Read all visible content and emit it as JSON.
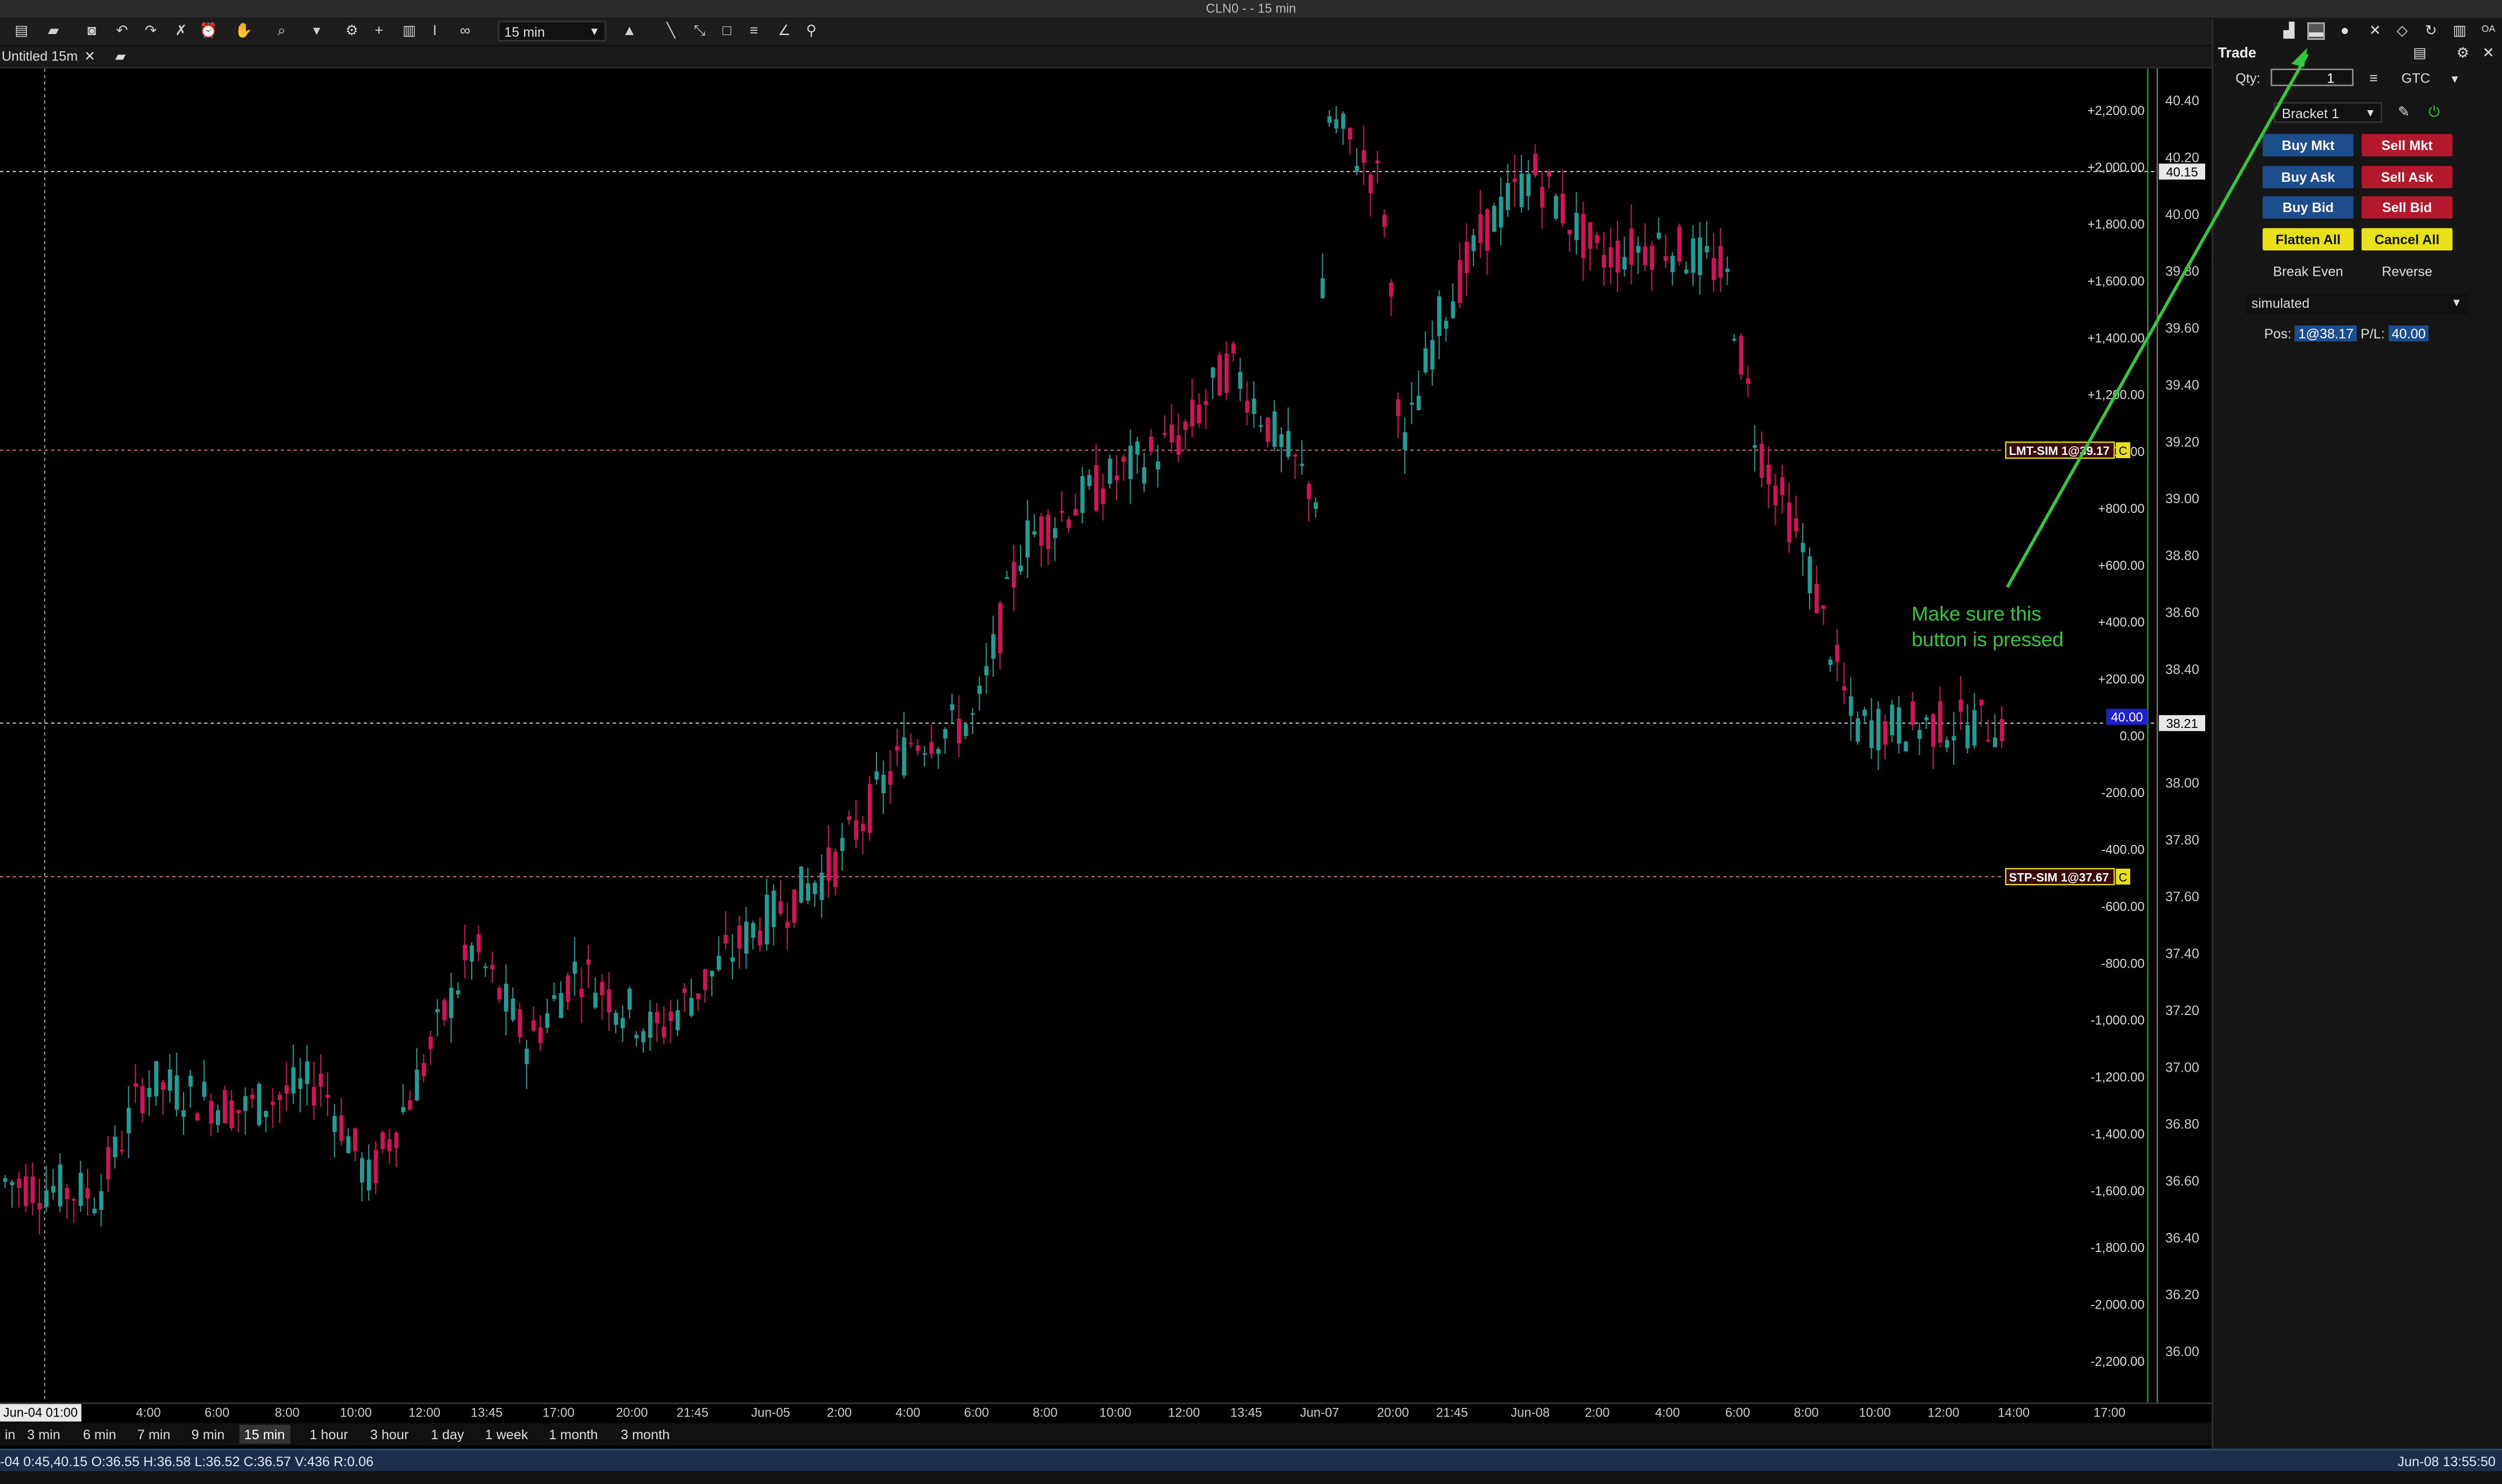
{
  "window": {
    "title": "CLN0 -  - 15 min"
  },
  "toolbar": {
    "timeframe": "15 min"
  },
  "tab": {
    "label": "Untitled 15m",
    "close": "✕"
  },
  "chart": {
    "colors": {
      "up": "#1f9e96",
      "down": "#d3125c",
      "grid_line": "#cfcfcf",
      "pnl_axis": "#2e9c3a"
    },
    "price_ticks": [
      "40.40",
      "40.20",
      "40.00",
      "39.80",
      "39.60",
      "39.40",
      "39.20",
      "39.00",
      "38.80",
      "38.60",
      "38.40",
      "38.20",
      "38.00",
      "37.80",
      "37.60",
      "37.40",
      "37.20",
      "37.00",
      "36.80",
      "36.60",
      "36.40",
      "36.20",
      "36.00"
    ],
    "pnl_ticks": [
      "+2,200.00",
      "+2,000.00",
      "+1,800.00",
      "+1,600.00",
      "+1,400.00",
      "+1,200.00",
      "+1,000.00",
      "+800.00",
      "+600.00",
      "+400.00",
      "+200.00",
      "0.00",
      "-200.00",
      "-400.00",
      "-600.00",
      "-800.00",
      "-1,000.00",
      "-1,200.00",
      "-1,400.00",
      "-1,600.00",
      "-1,800.00",
      "-2,000.00",
      "-2,200.00"
    ],
    "last_price_tag": "40.15",
    "current_price_tag": "38.21",
    "pnl_tag": "40.00",
    "orders": {
      "limit": {
        "label": "LMT-SIM 1@39.17",
        "price": 39.17,
        "cancel": "C"
      },
      "stop": {
        "label": "STP-SIM 1@37.67",
        "price": 37.67,
        "cancel": "C"
      }
    },
    "levels": {
      "high_line": 40.15,
      "position_line": 38.21
    },
    "x_labels": [
      "4:00",
      "6:00",
      "8:00",
      "10:00",
      "12:00",
      "13:45",
      "17:00",
      "20:00",
      "21:45",
      "Jun-05",
      "2:00",
      "4:00",
      "6:00",
      "8:00",
      "10:00",
      "12:00",
      "13:45",
      "Jun-07",
      "20:00",
      "21:45",
      "Jun-08",
      "2:00",
      "4:00",
      "6:00",
      "8:00",
      "10:00",
      "12:00",
      "14:00",
      "17:00"
    ],
    "x_first": "Jun-04 01:00"
  },
  "periods": [
    "in",
    "3 min",
    "6 min",
    "7 min",
    "9 min",
    "15 min",
    "1 hour",
    "3 hour",
    "1 day",
    "1 week",
    "1 month",
    "3 month"
  ],
  "periods_active": "15 min",
  "status": {
    "bar_info": "-04 0:45,40.15 O:36.55 H:36.58 L:36.52 C:36.57 V:436 R:0.06",
    "time": "Jun-08 13:55:50"
  },
  "trade_panel": {
    "title": "Trade",
    "qty_label": "Qty:",
    "qty_value": "1",
    "tif": "GTC",
    "bracket": "Bracket 1",
    "buttons": {
      "buy_mkt": "Buy Mkt",
      "sell_mkt": "Sell Mkt",
      "buy_ask": "Buy Ask",
      "sell_ask": "Sell Ask",
      "buy_bid": "Buy Bid",
      "sell_bid": "Sell Bid",
      "flatten_all": "Flatten All",
      "cancel_all": "Cancel All",
      "break_even": "Break Even",
      "reverse": "Reverse"
    },
    "account": "simulated",
    "pos_label": "Pos:",
    "pos_value": "1@38.17",
    "pl_label": "P/L:",
    "pl_value": "40.00"
  },
  "annotation": {
    "line1": "Make sure this",
    "line2": "button is pressed",
    "color": "#34c63c"
  }
}
